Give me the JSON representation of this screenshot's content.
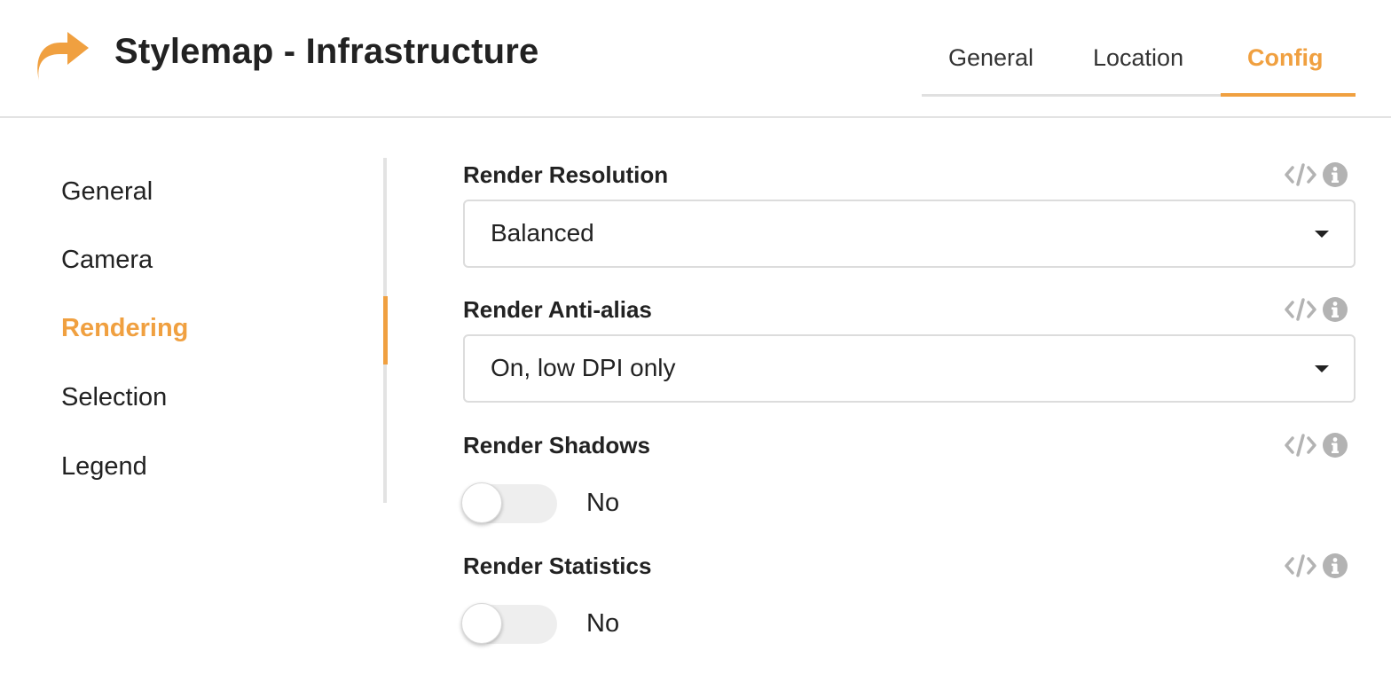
{
  "header": {
    "title": "Stylemap - Infrastructure",
    "logo_icon": "share-arrow-icon",
    "accent_color": "#f0a040",
    "tabs": [
      {
        "label": "General",
        "active": false
      },
      {
        "label": "Location",
        "active": false
      },
      {
        "label": "Config",
        "active": true
      }
    ]
  },
  "sidebar": {
    "items": [
      {
        "label": "General",
        "active": false
      },
      {
        "label": "Camera",
        "active": false
      },
      {
        "label": "Rendering",
        "active": true
      },
      {
        "label": "Selection",
        "active": false
      },
      {
        "label": "Legend",
        "active": false
      }
    ]
  },
  "fields": {
    "resolution": {
      "label": "Render Resolution",
      "value": "Balanced",
      "icons": [
        "code-icon",
        "info-icon"
      ]
    },
    "antialias": {
      "label": "Render Anti-alias",
      "value": "On, low DPI only",
      "icons": [
        "code-icon",
        "info-icon"
      ]
    },
    "shadows": {
      "label": "Render Shadows",
      "value": "No",
      "enabled": false,
      "icons": [
        "code-icon",
        "info-icon"
      ]
    },
    "statistics": {
      "label": "Render Statistics",
      "value": "No",
      "enabled": false,
      "icons": [
        "code-icon",
        "info-icon"
      ]
    }
  }
}
